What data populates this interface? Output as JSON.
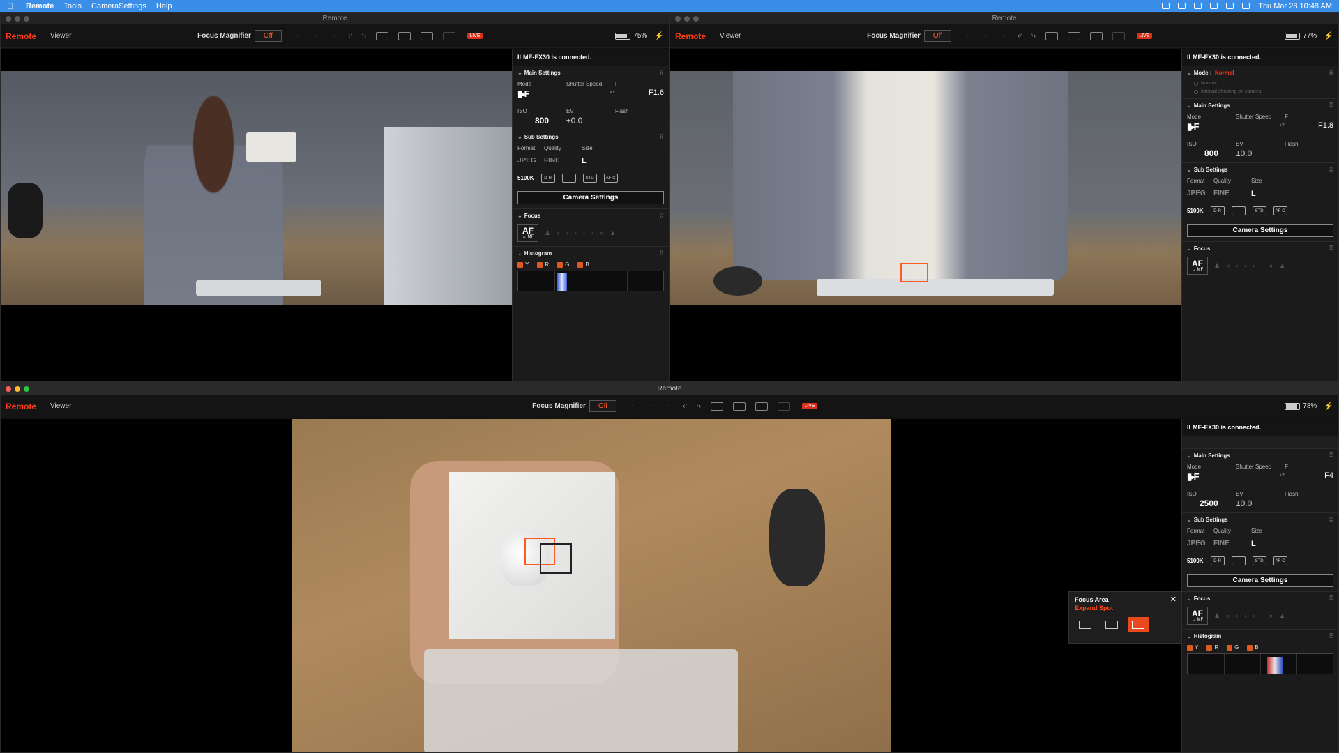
{
  "menubar": {
    "app": "Remote",
    "items": [
      "Tools",
      "CameraSettings",
      "Help"
    ],
    "clock": "Thu Mar 28  10:48 AM"
  },
  "windows": [
    {
      "title": "Remote",
      "brand": "Remote",
      "viewer": "Viewer",
      "focus_magnifier": "Focus Magnifier",
      "off": "Off",
      "dash": "-",
      "battery": "75%",
      "battery_level": 0.75,
      "connected": "ILME-FX30 is connected.",
      "main": {
        "heading": "Main Settings",
        "mode_label": "Mode",
        "shutter_label": "Shutter Speed",
        "f_label": "F",
        "f_value": "F1.6",
        "iso_label": "ISO",
        "ev_label": "EV",
        "flash_label": "Flash",
        "iso_value": "800",
        "ev_value": "±0.0"
      },
      "sub": {
        "heading": "Sub Settings",
        "format_label": "Format",
        "quality_label": "Quality",
        "size_label": "Size",
        "format": "JPEG",
        "quality": "FINE",
        "size": "L",
        "wb": "5100K"
      },
      "camera_settings": "Camera Settings",
      "focus": {
        "heading": "Focus",
        "af": "AF",
        "mf": "↔ MF"
      },
      "histogram": {
        "heading": "Histogram",
        "channels": [
          "Y",
          "R",
          "G",
          "B"
        ]
      }
    },
    {
      "title": "Remote",
      "brand": "Remote",
      "viewer": "Viewer",
      "focus_magnifier": "Focus Magnifier",
      "off": "Off",
      "dash": "-",
      "battery": "77%",
      "battery_level": 0.77,
      "connected": "ILME-FX30 is connected.",
      "mode_section": {
        "label": "Mode :",
        "value": "Normal",
        "options": [
          "Normal",
          "Interval shooting on camera"
        ]
      },
      "main": {
        "heading": "Main Settings",
        "mode_label": "Mode",
        "shutter_label": "Shutter Speed",
        "f_label": "F",
        "f_value": "F1.8",
        "iso_label": "ISO",
        "ev_label": "EV",
        "flash_label": "Flash",
        "iso_value": "800",
        "ev_value": "±0.0"
      },
      "sub": {
        "heading": "Sub Settings",
        "format_label": "Format",
        "quality_label": "Quality",
        "size_label": "Size",
        "format": "JPEG",
        "quality": "FINE",
        "size": "L",
        "wb": "5100K"
      },
      "camera_settings": "Camera Settings",
      "focus": {
        "heading": "Focus",
        "af": "AF",
        "mf": "↔ MF"
      }
    },
    {
      "title": "Remote",
      "brand": "Remote",
      "viewer": "Viewer",
      "focus_magnifier": "Focus Magnifier",
      "off": "Off",
      "dash": "-",
      "battery": "78%",
      "battery_level": 0.78,
      "connected": "ILME-FX30 is connected.",
      "main": {
        "heading": "Main Settings",
        "mode_label": "Mode",
        "shutter_label": "Shutter Speed",
        "f_label": "F",
        "f_value": "F4",
        "iso_label": "ISO",
        "ev_label": "EV",
        "flash_label": "Flash",
        "iso_value": "2500",
        "ev_value": "±0.0"
      },
      "sub": {
        "heading": "Sub Settings",
        "format_label": "Format",
        "quality_label": "Quality",
        "size_label": "Size",
        "format": "JPEG",
        "quality": "FINE",
        "size": "L",
        "wb": "5100K"
      },
      "camera_settings": "Camera Settings",
      "focus": {
        "heading": "Focus",
        "af": "AF",
        "mf": "↔ MF"
      },
      "histogram": {
        "heading": "Histogram",
        "channels": [
          "Y",
          "R",
          "G",
          "B"
        ]
      },
      "focus_area": {
        "title": "Focus Area",
        "value": "Expand Spot",
        "close": "✕"
      }
    }
  ],
  "colors": {
    "accent": "#ff3b1a",
    "menubar": "#3a8ee8",
    "panel": "#1b1b1b"
  }
}
